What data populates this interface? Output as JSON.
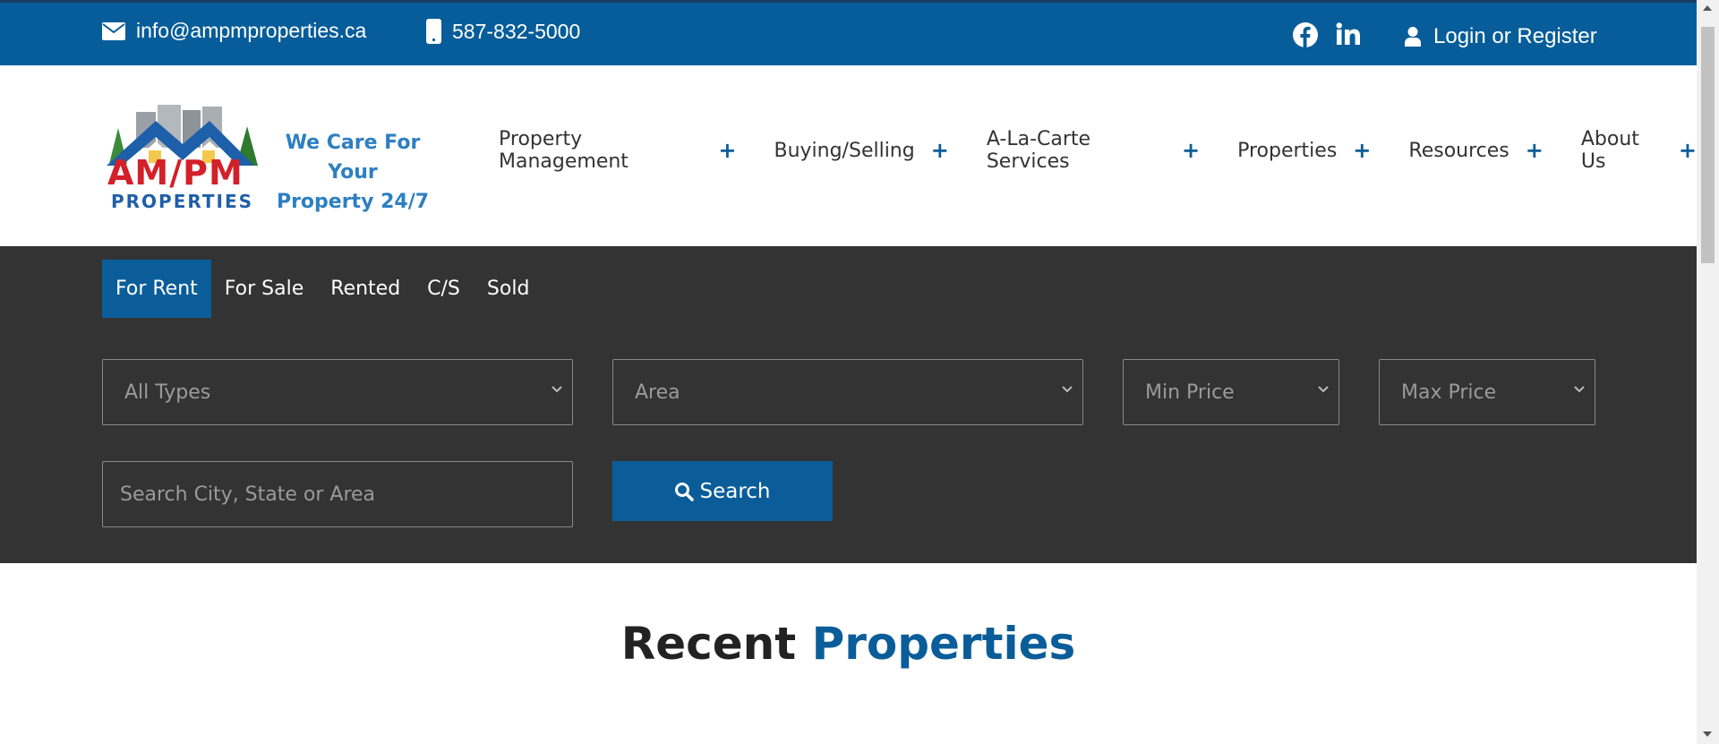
{
  "topbar": {
    "email": "info@ampmproperties.ca",
    "phone": "587-832-5000",
    "social": [
      "facebook-icon",
      "linkedin-icon"
    ],
    "login": "Login or Register"
  },
  "logo": {
    "tagline_line1": "We Care For Your",
    "tagline_line2": "Property 24/7",
    "brand": "AM/PM",
    "brand_sub": "PROPERTIES"
  },
  "nav": {
    "items": [
      {
        "label": "Property Management"
      },
      {
        "label": "Buying/Selling"
      },
      {
        "label": "A-La-Carte Services"
      },
      {
        "label": "Properties"
      },
      {
        "label": "Resources"
      },
      {
        "label": "About Us"
      }
    ],
    "expand_symbol": "+"
  },
  "search": {
    "tabs": [
      {
        "label": "For Rent",
        "active": true
      },
      {
        "label": "For Sale",
        "active": false
      },
      {
        "label": "Rented",
        "active": false
      },
      {
        "label": "C/S",
        "active": false
      },
      {
        "label": "Sold",
        "active": false
      }
    ],
    "selects": {
      "types": "All Types",
      "area": "Area",
      "min_price": "Min Price",
      "max_price": "Max Price"
    },
    "city_placeholder": "Search City, State or Area",
    "button": "Search"
  },
  "recent": {
    "word1": "Recent",
    "word2": "Properties"
  },
  "colors": {
    "primary": "#075d99",
    "dark_band": "#333333",
    "logo_red": "#d3202a",
    "tagline_blue": "#2d7fc1"
  }
}
